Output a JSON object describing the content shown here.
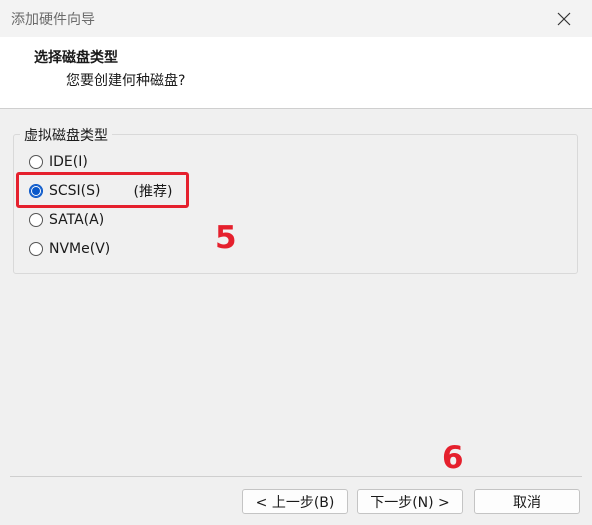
{
  "window": {
    "title": "添加硬件向导"
  },
  "header": {
    "title": "选择磁盘类型",
    "subtitle": "您要创建何种磁盘?"
  },
  "disk_type": {
    "group_label": "虚拟磁盘类型",
    "options": [
      {
        "label": "IDE(I)",
        "selected": false
      },
      {
        "label": "SCSI(S)",
        "note": "(推荐)",
        "selected": true
      },
      {
        "label": "SATA(A)",
        "selected": false
      },
      {
        "label": "NVMe(V)",
        "selected": false
      }
    ]
  },
  "annotations": {
    "step5": "5",
    "step6": "6",
    "color": "#e5202d"
  },
  "buttons": {
    "back": "< 上一步(B)",
    "next": "下一步(N) >",
    "cancel": "取消"
  },
  "colors": {
    "accent": "#0a58ca",
    "highlight": "#e5202d"
  }
}
